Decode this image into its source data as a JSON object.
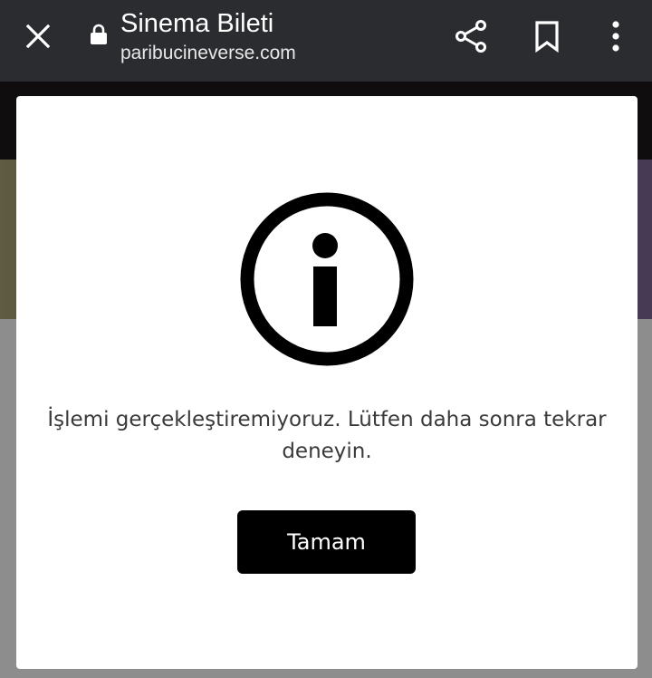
{
  "browser": {
    "title": "Sinema Bileti",
    "url": "paribucineverse.com",
    "icons": {
      "close": "close-icon",
      "lock": "lock-icon",
      "share": "share-icon",
      "bookmark": "bookmark-icon",
      "more": "more-vertical-icon"
    }
  },
  "dialog": {
    "icon": "info-icon",
    "message": "İşlemi gerçekleştiremiyoruz. Lütfen daha sonra tekrar deneyin.",
    "button_label": "Tamam"
  },
  "colors": {
    "toolbar_bg": "#2b2c30",
    "button_bg": "#000000",
    "modal_bg": "#ffffff"
  }
}
